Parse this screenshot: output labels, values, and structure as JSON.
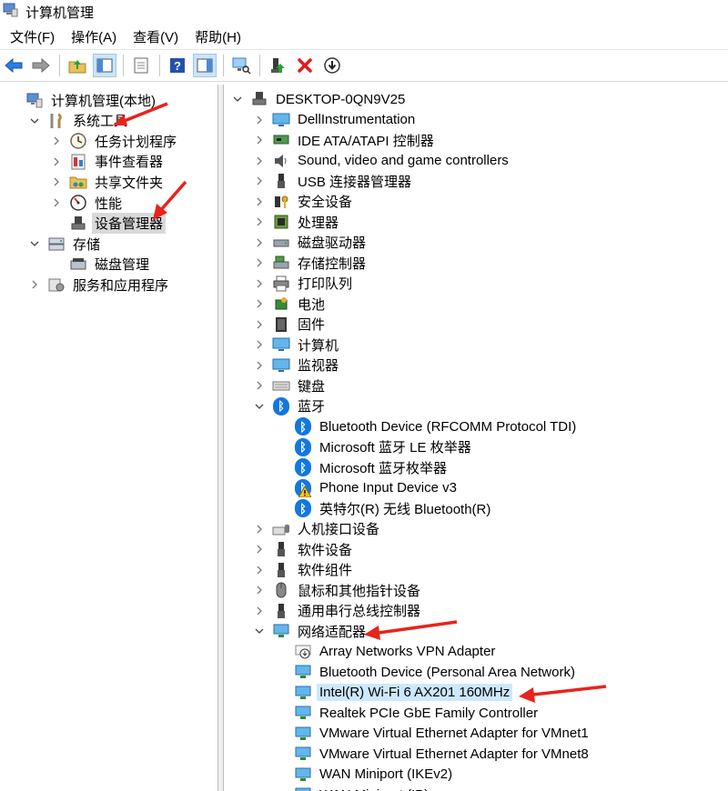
{
  "window": {
    "title": "计算机管理"
  },
  "menu": [
    "文件(F)",
    "操作(A)",
    "查看(V)",
    "帮助(H)"
  ],
  "left_tree": [
    {
      "label": "计算机管理(本地)",
      "level": 0,
      "icon": "computer-management-icon",
      "chevron": "none"
    },
    {
      "label": "系统工具",
      "level": 1,
      "icon": "tools-icon",
      "chevron": "down"
    },
    {
      "label": "任务计划程序",
      "level": 2,
      "icon": "clock-icon",
      "chevron": "right"
    },
    {
      "label": "事件查看器",
      "level": 2,
      "icon": "event-viewer-icon",
      "chevron": "right"
    },
    {
      "label": "共享文件夹",
      "level": 2,
      "icon": "shared-folder-icon",
      "chevron": "right"
    },
    {
      "label": "性能",
      "level": 2,
      "icon": "performance-icon",
      "chevron": "right"
    },
    {
      "label": "设备管理器",
      "level": 2,
      "icon": "device-manager-icon",
      "chevron": "none",
      "selected": true
    },
    {
      "label": "存储",
      "level": 1,
      "icon": "storage-icon",
      "chevron": "down"
    },
    {
      "label": "磁盘管理",
      "level": 2,
      "icon": "disk-icon",
      "chevron": "none"
    },
    {
      "label": "服务和应用程序",
      "level": 1,
      "icon": "services-icon",
      "chevron": "right"
    }
  ],
  "device_tree": [
    {
      "label": "DESKTOP-0QN9V25",
      "level": 0,
      "icon": "pc-icon",
      "chevron": "down"
    },
    {
      "label": "DellInstrumentation",
      "level": 1,
      "icon": "monitor-icon",
      "chevron": "right"
    },
    {
      "label": "IDE ATA/ATAPI 控制器",
      "level": 1,
      "icon": "controller-icon",
      "chevron": "right"
    },
    {
      "label": "Sound, video and game controllers",
      "level": 1,
      "icon": "speaker-icon",
      "chevron": "right"
    },
    {
      "label": "USB 连接器管理器",
      "level": 1,
      "icon": "usb-icon",
      "chevron": "right"
    },
    {
      "label": "安全设备",
      "level": 1,
      "icon": "key-icon",
      "chevron": "right"
    },
    {
      "label": "处理器",
      "level": 1,
      "icon": "chip-icon",
      "chevron": "right"
    },
    {
      "label": "磁盘驱动器",
      "level": 1,
      "icon": "disk-drive-icon",
      "chevron": "right"
    },
    {
      "label": "存储控制器",
      "level": 1,
      "icon": "storage-controller-icon",
      "chevron": "right"
    },
    {
      "label": "打印队列",
      "level": 1,
      "icon": "printer-icon",
      "chevron": "right"
    },
    {
      "label": "电池",
      "level": 1,
      "icon": "battery-icon",
      "chevron": "right"
    },
    {
      "label": "固件",
      "level": 1,
      "icon": "firmware-icon",
      "chevron": "right"
    },
    {
      "label": "计算机",
      "level": 1,
      "icon": "monitor-icon",
      "chevron": "right"
    },
    {
      "label": "监视器",
      "level": 1,
      "icon": "monitor-icon",
      "chevron": "right"
    },
    {
      "label": "键盘",
      "level": 1,
      "icon": "keyboard-icon",
      "chevron": "right"
    },
    {
      "label": "蓝牙",
      "level": 1,
      "icon": "bluetooth-icon",
      "chevron": "down"
    },
    {
      "label": "Bluetooth Device (RFCOMM Protocol TDI)",
      "level": 2,
      "icon": "bluetooth-icon",
      "chevron": "none"
    },
    {
      "label": "Microsoft 蓝牙 LE 枚举器",
      "level": 2,
      "icon": "bluetooth-icon",
      "chevron": "none"
    },
    {
      "label": "Microsoft 蓝牙枚举器",
      "level": 2,
      "icon": "bluetooth-icon",
      "chevron": "none"
    },
    {
      "label": "Phone Input Device v3",
      "level": 2,
      "icon": "bluetooth-warning-icon",
      "chevron": "none"
    },
    {
      "label": "英特尔(R) 无线 Bluetooth(R)",
      "level": 2,
      "icon": "bluetooth-icon",
      "chevron": "none"
    },
    {
      "label": "人机接口设备",
      "level": 1,
      "icon": "hid-icon",
      "chevron": "right"
    },
    {
      "label": "软件设备",
      "level": 1,
      "icon": "usb-icon",
      "chevron": "right"
    },
    {
      "label": "软件组件",
      "level": 1,
      "icon": "usb-icon",
      "chevron": "right"
    },
    {
      "label": "鼠标和其他指针设备",
      "level": 1,
      "icon": "mouse-icon",
      "chevron": "right"
    },
    {
      "label": "通用串行总线控制器",
      "level": 1,
      "icon": "usb-icon",
      "chevron": "right"
    },
    {
      "label": "网络适配器",
      "level": 1,
      "icon": "network-icon",
      "chevron": "down"
    },
    {
      "label": "Array Networks VPN Adapter",
      "level": 2,
      "icon": "vpn-adapter-icon",
      "chevron": "none"
    },
    {
      "label": "Bluetooth Device (Personal Area Network)",
      "level": 2,
      "icon": "network-icon",
      "chevron": "none"
    },
    {
      "label": "Intel(R) Wi-Fi 6 AX201 160MHz",
      "level": 2,
      "icon": "network-icon",
      "chevron": "none",
      "highlighted": true
    },
    {
      "label": "Realtek PCIe GbE Family Controller",
      "level": 2,
      "icon": "network-icon",
      "chevron": "none"
    },
    {
      "label": "VMware Virtual Ethernet Adapter for VMnet1",
      "level": 2,
      "icon": "network-icon",
      "chevron": "none"
    },
    {
      "label": "VMware Virtual Ethernet Adapter for VMnet8",
      "level": 2,
      "icon": "network-icon",
      "chevron": "none"
    },
    {
      "label": "WAN Miniport (IKEv2)",
      "level": 2,
      "icon": "network-icon",
      "chevron": "none"
    },
    {
      "label": "WAN Miniport (IP)",
      "level": 2,
      "icon": "network-icon",
      "chevron": "none"
    }
  ],
  "colors": {
    "arrow": "#e8231c",
    "selection": "#d9d9d9",
    "highlight": "#cce8ff",
    "bluetooth": "#1277e0"
  }
}
